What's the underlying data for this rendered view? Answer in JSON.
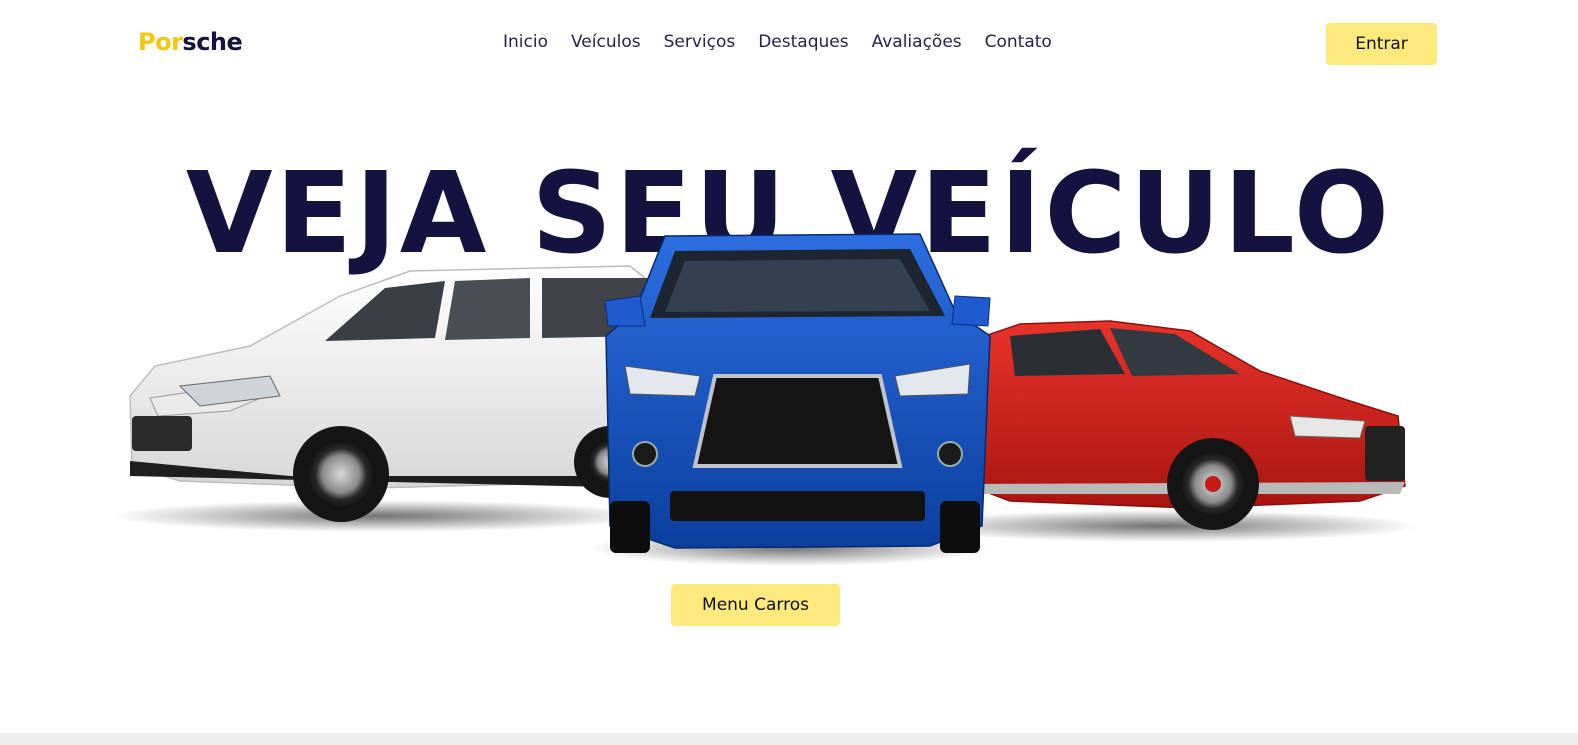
{
  "header": {
    "logo_part1": "Por",
    "logo_part2": "sche",
    "login_label": "Entrar"
  },
  "nav": {
    "items": [
      "Inicio",
      "Veículos",
      "Serviços",
      "Destaques",
      "Avaliações",
      "Contato"
    ]
  },
  "hero": {
    "title": "VEJA SEU VEÍCULO",
    "cta_label": "Menu Carros"
  },
  "colors": {
    "accent_yellow": "#fde97c",
    "logo_yellow": "#f2c70f",
    "title_navy": "#14133f",
    "car_white": "#f1f1f1",
    "car_blue": "#1251c4",
    "car_red": "#d8231b"
  }
}
